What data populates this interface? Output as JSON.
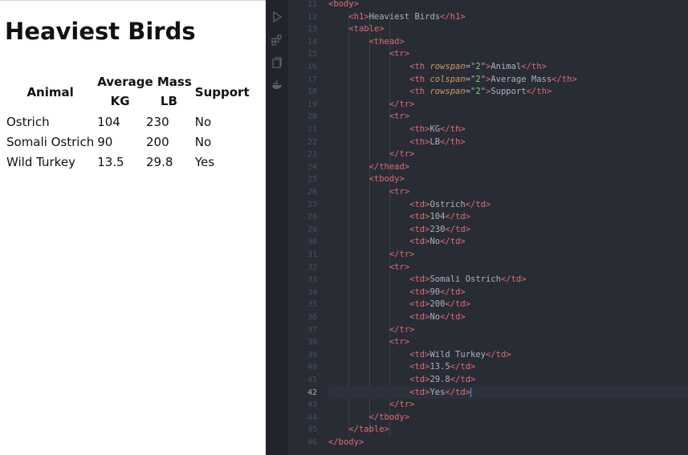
{
  "preview": {
    "heading": "Heaviest Birds",
    "table": {
      "headers": {
        "animal": "Animal",
        "average_mass": "Average Mass",
        "support": "Support",
        "kg": "KG",
        "lb": "LB"
      },
      "rows": [
        {
          "animal": "Ostrich",
          "kg": "104",
          "lb": "230",
          "support": "No"
        },
        {
          "animal": "Somali Ostrich",
          "kg": "90",
          "lb": "200",
          "support": "No"
        },
        {
          "animal": "Wild Turkey",
          "kg": "13.5",
          "lb": "29.8",
          "support": "Yes"
        }
      ]
    }
  },
  "editor": {
    "active_line": "42",
    "colors": {
      "background": "#282c34",
      "tag": "#e06c75",
      "attribute": "#d19a66",
      "string": "#98c379",
      "text": "#abb2bf",
      "line_number": "#495162"
    },
    "activity_icons": [
      "debug-icon",
      "extensions-icon",
      "copy-icon",
      "docker-icon"
    ],
    "lines": [
      {
        "n": "11",
        "tokens": [
          [
            "tag",
            "<body>"
          ]
        ]
      },
      {
        "n": "12",
        "tokens": [
          [
            "ws",
            "    "
          ],
          [
            "tag",
            "<h1>"
          ],
          [
            "text",
            "Heaviest Birds"
          ],
          [
            "tag",
            "</h1>"
          ]
        ]
      },
      {
        "n": "13",
        "tokens": [
          [
            "ws",
            "    "
          ],
          [
            "tag",
            "<table>"
          ]
        ]
      },
      {
        "n": "14",
        "tokens": [
          [
            "ws",
            "        "
          ],
          [
            "tag",
            "<thead>"
          ]
        ]
      },
      {
        "n": "15",
        "tokens": [
          [
            "ws",
            "            "
          ],
          [
            "tag",
            "<tr>"
          ]
        ]
      },
      {
        "n": "16",
        "tokens": [
          [
            "ws",
            "                "
          ],
          [
            "tag",
            "<th "
          ],
          [
            "attr",
            "rowspan"
          ],
          [
            "punc",
            "="
          ],
          [
            "str",
            "\"2\""
          ],
          [
            "tag",
            ">"
          ],
          [
            "text",
            "Animal"
          ],
          [
            "tag",
            "</th>"
          ]
        ]
      },
      {
        "n": "17",
        "tokens": [
          [
            "ws",
            "                "
          ],
          [
            "tag",
            "<th "
          ],
          [
            "attr",
            "colspan"
          ],
          [
            "punc",
            "="
          ],
          [
            "str",
            "\"2\""
          ],
          [
            "tag",
            ">"
          ],
          [
            "text",
            "Average Mass"
          ],
          [
            "tag",
            "</th>"
          ]
        ]
      },
      {
        "n": "18",
        "tokens": [
          [
            "ws",
            "                "
          ],
          [
            "tag",
            "<th "
          ],
          [
            "attr",
            "rowspan"
          ],
          [
            "punc",
            "="
          ],
          [
            "str",
            "\"2\""
          ],
          [
            "tag",
            ">"
          ],
          [
            "text",
            "Support"
          ],
          [
            "tag",
            "</th>"
          ]
        ]
      },
      {
        "n": "19",
        "tokens": [
          [
            "ws",
            "            "
          ],
          [
            "tag",
            "</tr>"
          ]
        ]
      },
      {
        "n": "20",
        "tokens": [
          [
            "ws",
            "            "
          ],
          [
            "tag",
            "<tr>"
          ]
        ]
      },
      {
        "n": "21",
        "tokens": [
          [
            "ws",
            "                "
          ],
          [
            "tag",
            "<th>"
          ],
          [
            "text",
            "KG"
          ],
          [
            "tag",
            "</th>"
          ]
        ]
      },
      {
        "n": "22",
        "tokens": [
          [
            "ws",
            "                "
          ],
          [
            "tag",
            "<th>"
          ],
          [
            "text",
            "LB"
          ],
          [
            "tag",
            "</th>"
          ]
        ]
      },
      {
        "n": "23",
        "tokens": [
          [
            "ws",
            "            "
          ],
          [
            "tag",
            "</tr>"
          ]
        ]
      },
      {
        "n": "24",
        "tokens": [
          [
            "ws",
            "        "
          ],
          [
            "tag",
            "</thead>"
          ]
        ]
      },
      {
        "n": "25",
        "tokens": [
          [
            "ws",
            "        "
          ],
          [
            "tag",
            "<tbody>"
          ]
        ]
      },
      {
        "n": "26",
        "tokens": [
          [
            "ws",
            "            "
          ],
          [
            "tag",
            "<tr>"
          ]
        ]
      },
      {
        "n": "27",
        "tokens": [
          [
            "ws",
            "                "
          ],
          [
            "tag",
            "<td>"
          ],
          [
            "text",
            "Ostrich"
          ],
          [
            "tag",
            "</td>"
          ]
        ]
      },
      {
        "n": "28",
        "tokens": [
          [
            "ws",
            "                "
          ],
          [
            "tag",
            "<td>"
          ],
          [
            "text",
            "104"
          ],
          [
            "tag",
            "</td>"
          ]
        ]
      },
      {
        "n": "29",
        "tokens": [
          [
            "ws",
            "                "
          ],
          [
            "tag",
            "<td>"
          ],
          [
            "text",
            "230"
          ],
          [
            "tag",
            "</td>"
          ]
        ]
      },
      {
        "n": "30",
        "tokens": [
          [
            "ws",
            "                "
          ],
          [
            "tag",
            "<td>"
          ],
          [
            "text",
            "No"
          ],
          [
            "tag",
            "</td>"
          ]
        ]
      },
      {
        "n": "31",
        "tokens": [
          [
            "ws",
            "            "
          ],
          [
            "tag",
            "</tr>"
          ]
        ]
      },
      {
        "n": "32",
        "tokens": [
          [
            "ws",
            "            "
          ],
          [
            "tag",
            "<tr>"
          ]
        ]
      },
      {
        "n": "33",
        "tokens": [
          [
            "ws",
            "                "
          ],
          [
            "tag",
            "<td>"
          ],
          [
            "text",
            "Somali Ostrich"
          ],
          [
            "tag",
            "</td>"
          ]
        ]
      },
      {
        "n": "34",
        "tokens": [
          [
            "ws",
            "                "
          ],
          [
            "tag",
            "<td>"
          ],
          [
            "text",
            "90"
          ],
          [
            "tag",
            "</td>"
          ]
        ]
      },
      {
        "n": "35",
        "tokens": [
          [
            "ws",
            "                "
          ],
          [
            "tag",
            "<td>"
          ],
          [
            "text",
            "200"
          ],
          [
            "tag",
            "</td>"
          ]
        ]
      },
      {
        "n": "36",
        "tokens": [
          [
            "ws",
            "                "
          ],
          [
            "tag",
            "<td>"
          ],
          [
            "text",
            "No"
          ],
          [
            "tag",
            "</td>"
          ]
        ]
      },
      {
        "n": "37",
        "tokens": [
          [
            "ws",
            "            "
          ],
          [
            "tag",
            "</tr>"
          ]
        ]
      },
      {
        "n": "38",
        "tokens": [
          [
            "ws",
            "            "
          ],
          [
            "tag",
            "<tr>"
          ]
        ]
      },
      {
        "n": "39",
        "tokens": [
          [
            "ws",
            "                "
          ],
          [
            "tag",
            "<td>"
          ],
          [
            "text",
            "Wild Turkey"
          ],
          [
            "tag",
            "</td>"
          ]
        ]
      },
      {
        "n": "40",
        "tokens": [
          [
            "ws",
            "                "
          ],
          [
            "tag",
            "<td>"
          ],
          [
            "text",
            "13.5"
          ],
          [
            "tag",
            "</td>"
          ]
        ]
      },
      {
        "n": "41",
        "tokens": [
          [
            "ws",
            "                "
          ],
          [
            "tag",
            "<td>"
          ],
          [
            "text",
            "29.8"
          ],
          [
            "tag",
            "</td>"
          ]
        ]
      },
      {
        "n": "42",
        "tokens": [
          [
            "ws",
            "                "
          ],
          [
            "tag",
            "<td>"
          ],
          [
            "text",
            "Yes"
          ],
          [
            "tag",
            "</td>"
          ]
        ]
      },
      {
        "n": "43",
        "tokens": [
          [
            "ws",
            "            "
          ],
          [
            "tag",
            "</tr>"
          ]
        ]
      },
      {
        "n": "44",
        "tokens": [
          [
            "ws",
            "        "
          ],
          [
            "tag",
            "</tbody>"
          ]
        ]
      },
      {
        "n": "45",
        "tokens": [
          [
            "ws",
            "    "
          ],
          [
            "tag",
            "</table>"
          ]
        ]
      },
      {
        "n": "46",
        "tokens": [
          [
            "tag",
            "</body>"
          ]
        ]
      }
    ]
  }
}
